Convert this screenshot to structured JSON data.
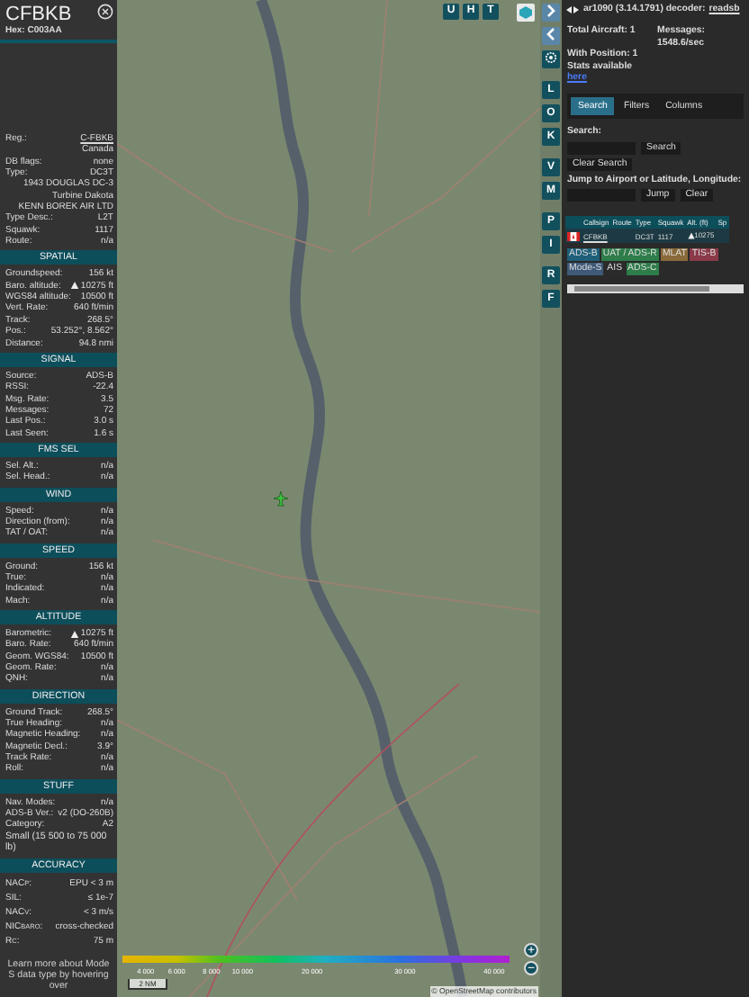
{
  "aircraft": {
    "callsign": "CFBKB",
    "hex": "Hex: C003AA"
  },
  "details": [
    {
      "kind": "link",
      "label": "Reg.:",
      "value": "C-FBKB"
    },
    {
      "kind": "value",
      "value": "Canada"
    },
    {
      "kind": "pair",
      "label": "DB flags:",
      "value": "none"
    },
    {
      "kind": "pair",
      "label": "Type:",
      "value": "DC3T"
    },
    {
      "kind": "value",
      "value": "1943 DOUGLAS DC-3 Turbine Dakota"
    },
    {
      "kind": "value",
      "value": "KENN BOREK AIR LTD"
    },
    {
      "kind": "pair",
      "label": "Type Desc.:",
      "value": "L2T"
    },
    {
      "kind": "pair",
      "label": "Squawk:",
      "value": "1117"
    },
    {
      "kind": "pair",
      "label": "Route:",
      "value": "n/a"
    }
  ],
  "sections": [
    {
      "title": "SPATIAL",
      "rows": [
        {
          "kind": "pair",
          "label": "Groundspeed:",
          "value": "156 kt"
        },
        {
          "kind": "climb",
          "label": "Baro. altitude:",
          "value": "10275 ft"
        },
        {
          "kind": "pair",
          "label": "WGS84 altitude:",
          "value": "10500 ft"
        },
        {
          "kind": "pair",
          "label": "Vert. Rate:",
          "value": "640 ft/min"
        },
        {
          "kind": "pair",
          "label": "Track:",
          "value": "268.5°"
        },
        {
          "kind": "pair",
          "label": "Pos.:",
          "value": "53.252°, 8.562°"
        },
        {
          "kind": "pair",
          "label": "Distance:",
          "value": "94.8 nmi"
        }
      ]
    },
    {
      "title": "SIGNAL",
      "rows": [
        {
          "kind": "pair",
          "label": "Source:",
          "value": "ADS-B"
        },
        {
          "kind": "pair",
          "label": "RSSI:",
          "value": "-22.4"
        },
        {
          "kind": "pair",
          "label": "Msg. Rate:",
          "value": "3.5"
        },
        {
          "kind": "pair",
          "label": "Messages:",
          "value": "72"
        },
        {
          "kind": "pair",
          "label": "Last Pos.:",
          "value": "3.0 s"
        },
        {
          "kind": "pair",
          "label": "Last Seen:",
          "value": "1.6 s"
        }
      ]
    },
    {
      "title": "FMS SEL",
      "rows": [
        {
          "kind": "pair",
          "label": "Sel. Alt.:",
          "value": "n/a"
        },
        {
          "kind": "pair",
          "label": "Sel. Head.:",
          "value": "n/a"
        }
      ]
    },
    {
      "title": "WIND",
      "rows": [
        {
          "kind": "pair",
          "label": "Speed:",
          "value": "n/a"
        },
        {
          "kind": "pair",
          "label": "Direction (from):",
          "value": "n/a"
        },
        {
          "kind": "pair",
          "label": "TAT / OAT:",
          "value": "n/a"
        }
      ]
    },
    {
      "title": "SPEED",
      "rows": [
        {
          "kind": "pair",
          "label": "Ground:",
          "value": "156 kt"
        },
        {
          "kind": "pair",
          "label": "True:",
          "value": "n/a"
        },
        {
          "kind": "pair",
          "label": "Indicated:",
          "value": "n/a"
        },
        {
          "kind": "pair",
          "label": "Mach:",
          "value": "n/a"
        }
      ]
    },
    {
      "title": "ALTITUDE",
      "rows": [
        {
          "kind": "climb",
          "label": "Barometric:",
          "value": "10275 ft"
        },
        {
          "kind": "pair",
          "label": "Baro. Rate:",
          "value": "640 ft/min"
        },
        {
          "kind": "pair",
          "label": "Geom. WGS84:",
          "value": "10500 ft"
        },
        {
          "kind": "pair",
          "label": "Geom. Rate:",
          "value": "n/a"
        },
        {
          "kind": "pair",
          "label": "QNH:",
          "value": "n/a"
        }
      ]
    },
    {
      "title": "DIRECTION",
      "rows": [
        {
          "kind": "pair",
          "label": "Ground Track:",
          "value": "268.5°"
        },
        {
          "kind": "pair",
          "label": "True Heading:",
          "value": "n/a"
        },
        {
          "kind": "pair",
          "label": "Magnetic Heading:",
          "value": "n/a"
        },
        {
          "kind": "pair",
          "label": "Magnetic Decl.:",
          "value": "3.9°"
        },
        {
          "kind": "pair",
          "label": "Track Rate:",
          "value": "n/a"
        },
        {
          "kind": "pair",
          "label": "Roll:",
          "value": "n/a"
        }
      ]
    },
    {
      "title": "STUFF",
      "rows": [
        {
          "kind": "pair",
          "label": "Nav. Modes:",
          "value": "n/a"
        },
        {
          "kind": "pair",
          "label": "ADS-B Ver.:",
          "value": "v2 (DO-260B)"
        },
        {
          "kind": "pair",
          "label": "Category:",
          "value": "A2"
        },
        {
          "kind": "full",
          "value": "Small (15 500 to 75 000 lb)"
        }
      ]
    },
    {
      "title": "ACCURACY",
      "rows": [
        {
          "kind": "pair",
          "label": "NAC$_{P}$:",
          "value": "EPU < 3 m"
        },
        {
          "kind": "pair",
          "label": "SIL:",
          "value": "≤ 1e-7"
        },
        {
          "kind": "pair",
          "label": "NAC$_{V}$:",
          "value": "< 3 m/s"
        },
        {
          "kind": "pair",
          "label": "NIC$_{BARO}$:",
          "value": "cross-checked"
        },
        {
          "kind": "pair",
          "label": "R$_{C}$:",
          "value": "75 m"
        }
      ]
    }
  ],
  "footer_note": "Learn more about Mode S data type by hovering over",
  "map": {
    "top_buttons": [
      "U",
      "H",
      "T"
    ],
    "altitude_legend": [
      "4 000",
      "6 000",
      "8 000",
      "10 000",
      "20 000",
      "30 000",
      "40 000"
    ],
    "zoom_in": "+",
    "zoom_out": "−",
    "scale": "2 NM",
    "attribution": "© OpenStreetMap contributors"
  },
  "side_buttons": [
    {
      "kind": "expand"
    },
    {
      "kind": "collapse"
    },
    {
      "kind": "settings"
    },
    {
      "kind": "letter",
      "label": "L"
    },
    {
      "kind": "letter",
      "label": "O"
    },
    {
      "kind": "letter",
      "label": "K"
    },
    {
      "kind": "letter",
      "label": "V"
    },
    {
      "kind": "letter",
      "label": "M"
    },
    {
      "kind": "letter",
      "label": "P"
    },
    {
      "kind": "letter",
      "label": "I"
    },
    {
      "kind": "letter",
      "label": "R"
    },
    {
      "kind": "letter",
      "label": "F"
    }
  ],
  "header": {
    "version": "ar1090 (3.14.1791) decoder:",
    "decoder": "readsb"
  },
  "stats": {
    "total": "Total Aircraft: 1",
    "messages": "Messages: 1548.6/sec",
    "with_position": "With Position: 1",
    "stats_available": "Stats available",
    "stats_link": "here"
  },
  "tabs": [
    {
      "label": "Search",
      "selected": true
    },
    {
      "label": "Filters",
      "selected": false
    },
    {
      "label": "Columns",
      "selected": false
    }
  ],
  "search": {
    "label": "Search:",
    "button": "Search",
    "clear": "Clear Search",
    "jump_label": "Jump to Airport or Latitude, Longitude:",
    "jump_button": "Jump",
    "jump_clear": "Clear"
  },
  "table": {
    "columns": [
      "Callsign",
      "Route",
      "Type",
      "Squawk",
      "Alt. (ft)",
      "Sp"
    ],
    "rows": [
      {
        "selected": true,
        "callsign": "CFBKB",
        "route": "",
        "type": "DC3T",
        "squawk": "1117",
        "altitude": "10275"
      }
    ]
  },
  "source_tags": [
    {
      "label": "ADS-B",
      "color": "#1f5f7a"
    },
    {
      "label": "UAT / ADS-R",
      "color": "#2e7d4a"
    },
    {
      "label": "MLAT",
      "color": "#8a6a3a"
    },
    {
      "label": "TIS-B",
      "color": "#8a3a48"
    },
    {
      "label": "Mode-S",
      "color": "#3e5a78"
    },
    {
      "label": "AIS",
      "color": "#2b2b2b"
    },
    {
      "label": "ADS-C",
      "color": "#2e7d4a"
    }
  ]
}
